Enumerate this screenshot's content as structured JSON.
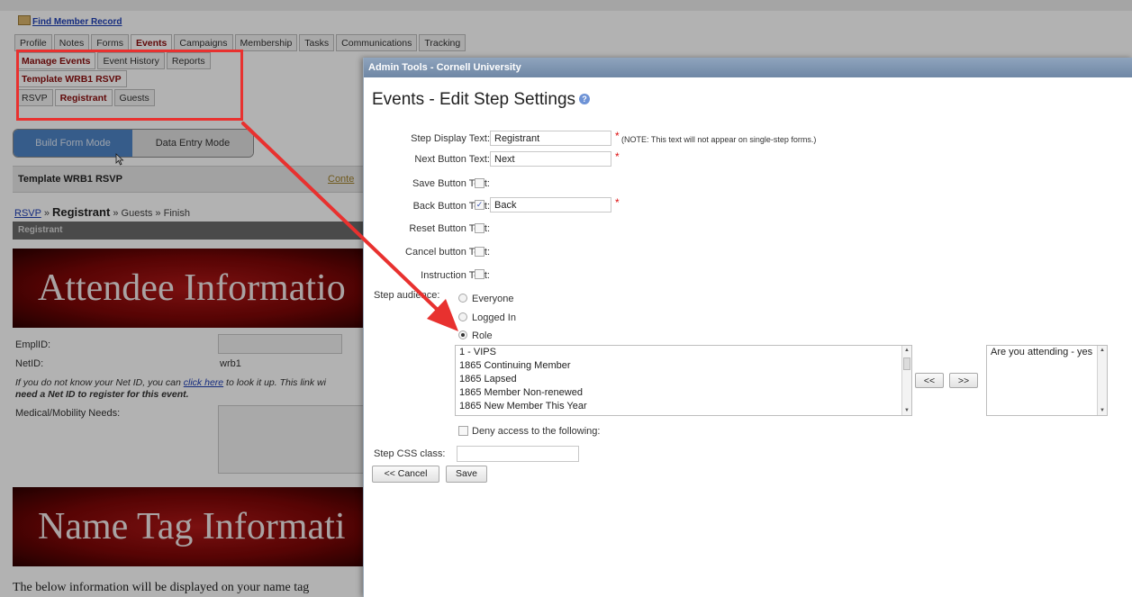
{
  "background": {
    "find_member": "Find Member Record",
    "tabs_main": [
      "Profile",
      "Notes",
      "Forms",
      "Events",
      "Campaigns",
      "Membership",
      "Tasks",
      "Communications",
      "Tracking"
    ],
    "tabs_events": [
      "Manage Events",
      "Event History",
      "Reports"
    ],
    "template_tab": "Template WRB1 RSVP",
    "tabs_steps": [
      "RSVP",
      "Registrant",
      "Guests"
    ],
    "mode_build": "Build Form Mode",
    "mode_entry": "Data Entry Mode",
    "template_title": "Template WRB1 RSVP",
    "template_link": "Conte",
    "breadcrumb": {
      "rsvp": "RSVP",
      "sep1": " » ",
      "registrant": "Registrant",
      "rest": " » Guests » Finish"
    },
    "section_header": "Registrant",
    "banner1": "Attendee Informatio",
    "emplid_label": "EmplID:",
    "netid_label": "NetID:",
    "netid_value": "wrb1",
    "help_pre": "If you do not know your Net ID, you can ",
    "help_link": "click here",
    "help_post": " to look it up. This link wi",
    "help_bold": "need a Net ID to register for this event.",
    "medical_label": "Medical/Mobility Needs:",
    "banner2": "Name Tag Informati",
    "bottom_text": "The below information will be displayed on your name tag"
  },
  "modal": {
    "titlebar": "Admin Tools - Cornell University",
    "heading": "Events - Edit Step Settings",
    "step_display_label": "Step Display Text:",
    "step_display_value": "Registrant",
    "step_display_note": "(NOTE: This text will not appear on single-step forms.)",
    "next_label": "Next Button Text:",
    "next_value": "Next",
    "save_label": "Save Button Text:",
    "back_label": "Back Button Text:",
    "back_value": "Back",
    "reset_label": "Reset Button Text:",
    "cancel_label": "Cancel button Text:",
    "instruction_label": "Instruction Text:",
    "audience_label": "Step audience:",
    "audience_options": [
      "Everyone",
      "Logged In",
      "Role"
    ],
    "audience_selected": "Role",
    "roles": [
      "1 - VIPS",
      "1865 Continuing Member",
      "1865 Lapsed",
      "1865 Member Non-renewed",
      "1865 New Member This Year"
    ],
    "selected_roles": [
      "Are you attending - yes"
    ],
    "move_left": "<<",
    "move_right": ">>",
    "deny_label": "Deny access to the following:",
    "css_label": "Step CSS class:",
    "cancel_button": "<< Cancel",
    "save_button": "Save",
    "required_mark": "*",
    "save_checked": false,
    "back_checked": true
  },
  "colors": {
    "annotation": "#e8312f",
    "titlebar": "#7a90ad",
    "banner": "#9a0f0f"
  }
}
